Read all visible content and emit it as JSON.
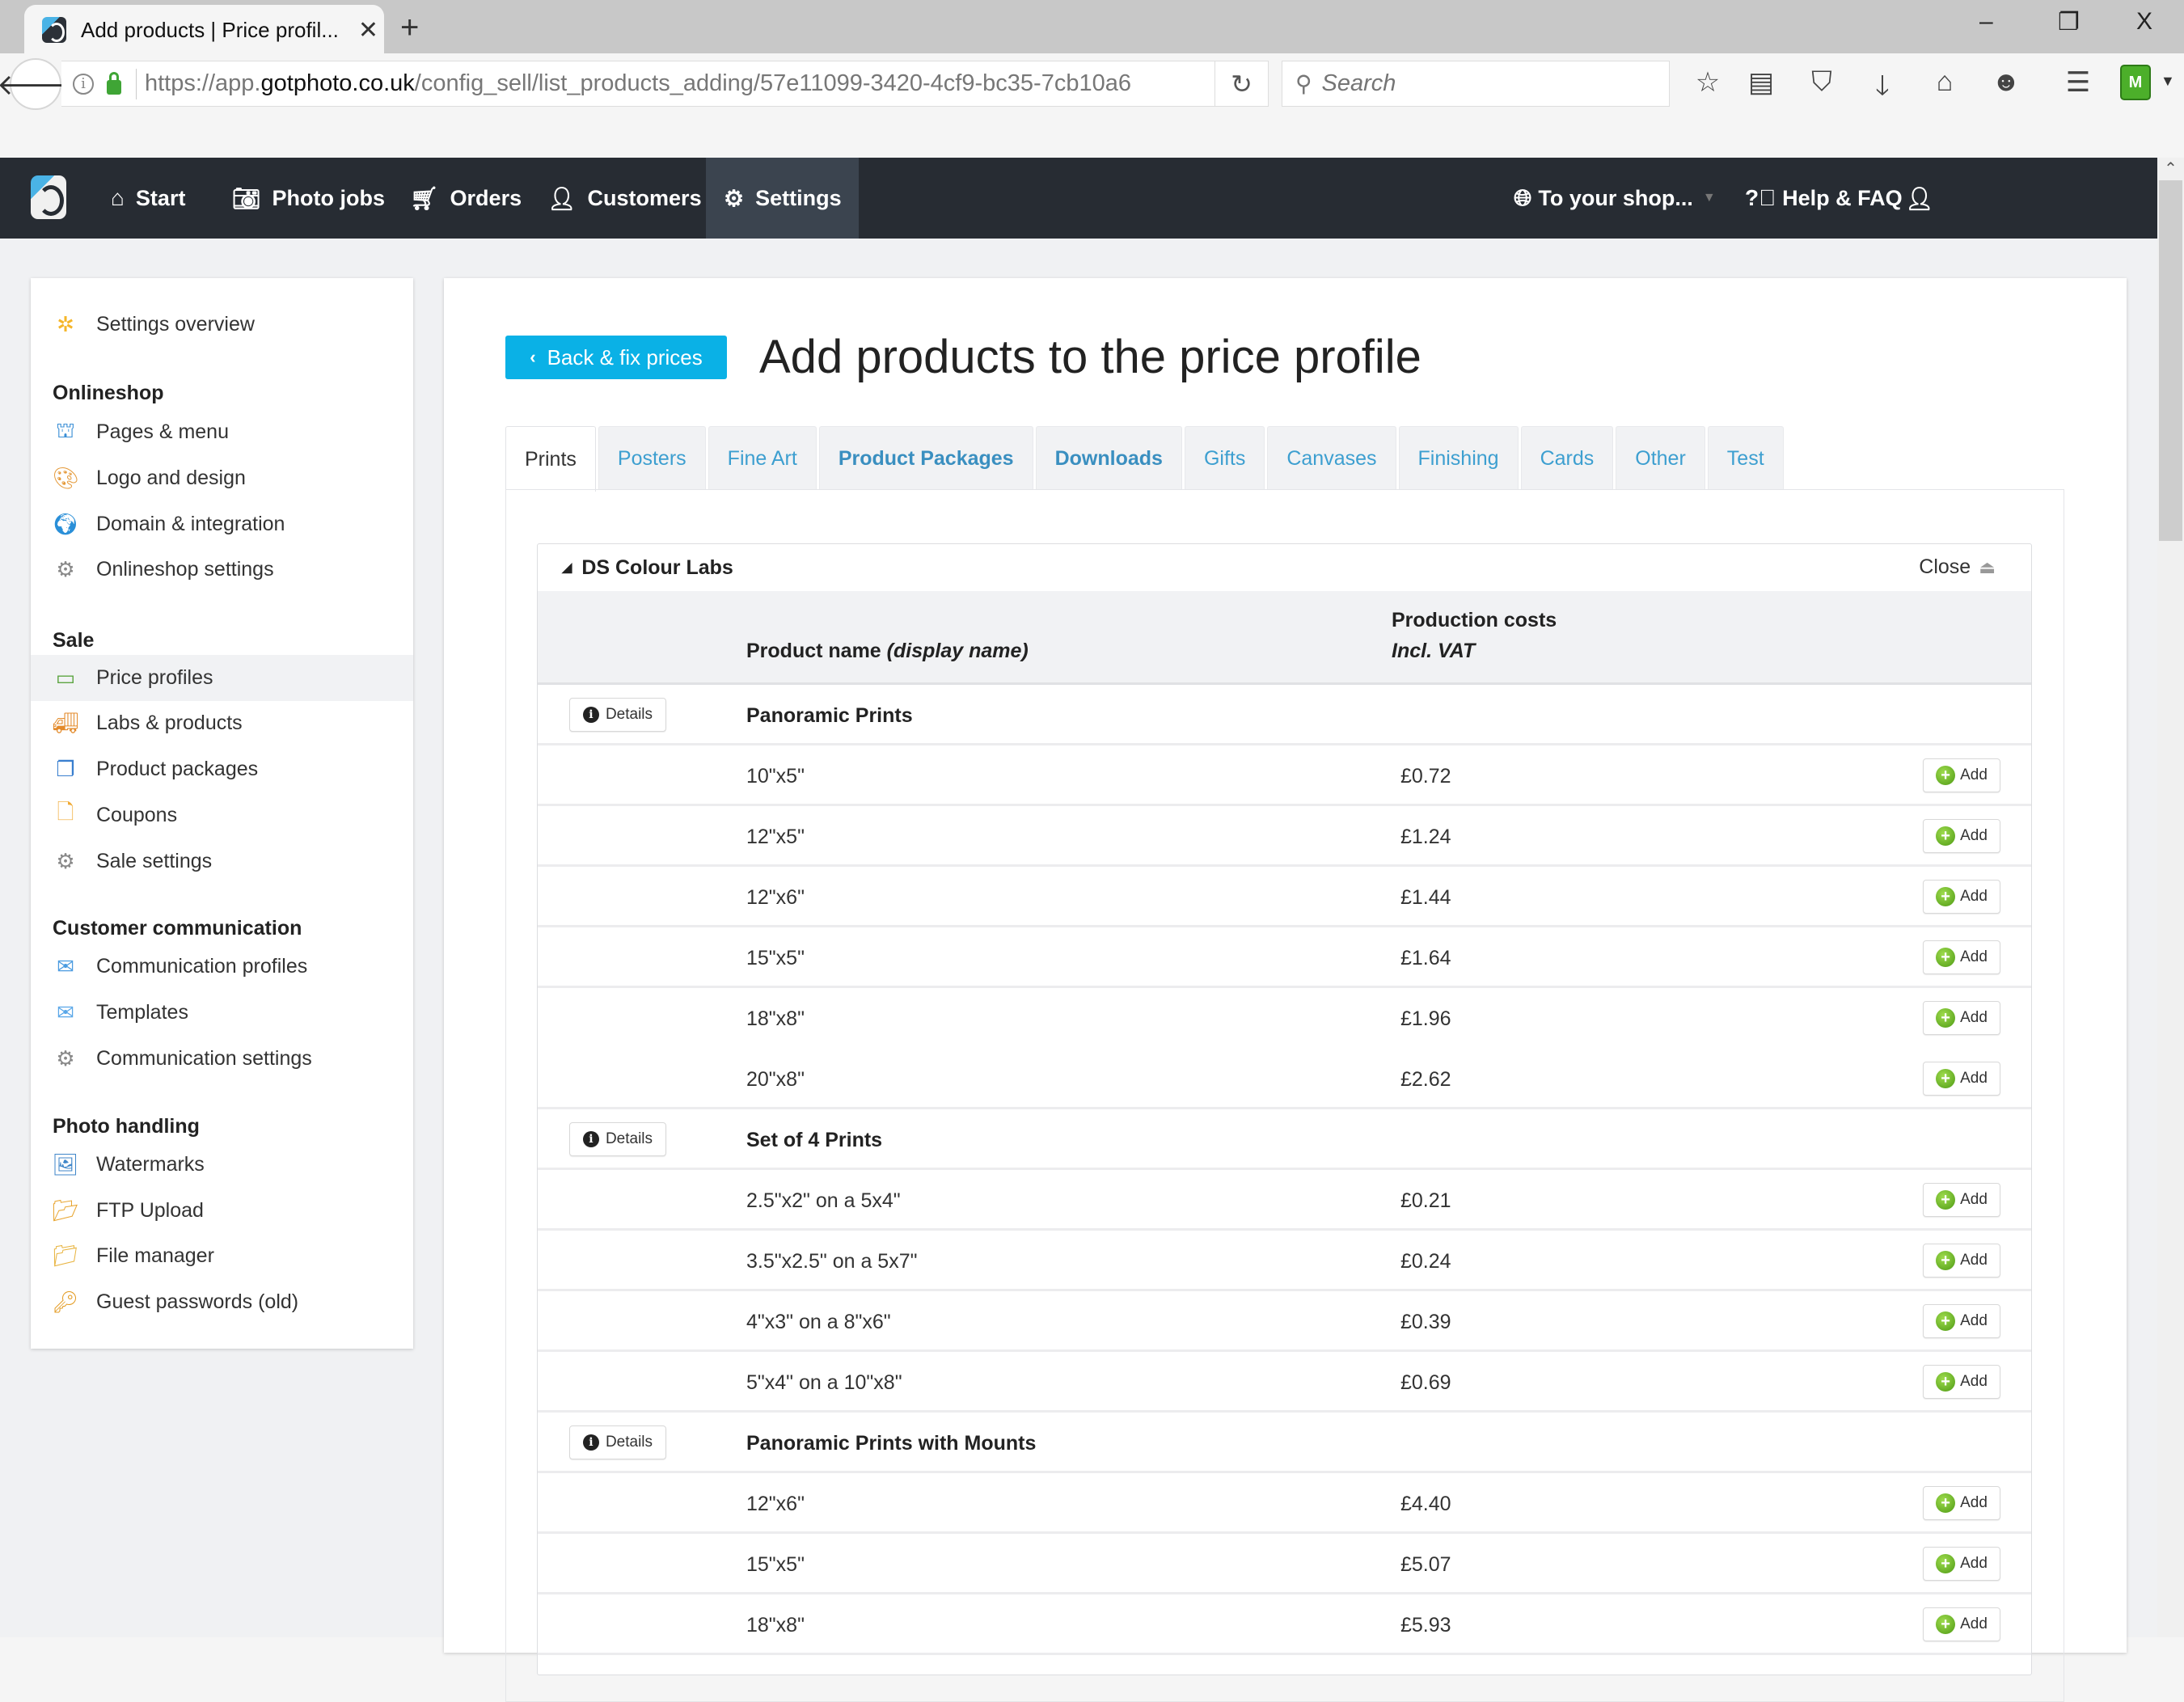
{
  "browser": {
    "tab_title": "Add products | Price profil...",
    "new_tab": "+",
    "window_controls": {
      "minimize": "–",
      "restore": "❐",
      "close": "X"
    },
    "url_prefix": "https://app.",
    "url_domain": "gotphoto.co.uk",
    "url_path": "/config_sell/list_products_adding/57e11099-3420-4cf9-bc35-7cb10a6",
    "search_placeholder": "Search",
    "toolbar_icons": [
      "star-icon",
      "reader-list-icon",
      "pocket-icon",
      "download-icon",
      "home-icon",
      "chat-icon",
      "menu-icon",
      "extension-icon"
    ]
  },
  "navbar": {
    "items": [
      {
        "label": "Start",
        "icon": "home-icon"
      },
      {
        "label": "Photo jobs",
        "icon": "camera-icon"
      },
      {
        "label": "Orders",
        "icon": "cart-icon"
      },
      {
        "label": "Customers",
        "icon": "user-icon"
      },
      {
        "label": "Settings",
        "icon": "gear-icon",
        "active": true
      }
    ],
    "right": {
      "shop": "To your shop...",
      "help": "Help & FAQ",
      "account_icon": "user-icon"
    }
  },
  "sidebar": {
    "overview": "Settings overview",
    "sections": [
      {
        "title": "Onlineshop",
        "items": [
          "Pages & menu",
          "Logo and design",
          "Domain & integration",
          "Onlineshop settings"
        ]
      },
      {
        "title": "Sale",
        "items": [
          "Price profiles",
          "Labs & products",
          "Product packages",
          "Coupons",
          "Sale settings"
        ],
        "active": "Price profiles"
      },
      {
        "title": "Customer communication",
        "items": [
          "Communication profiles",
          "Templates",
          "Communication settings"
        ]
      },
      {
        "title": "Photo handling",
        "items": [
          "Watermarks",
          "FTP Upload",
          "File manager",
          "Guest passwords (old)"
        ]
      }
    ]
  },
  "main": {
    "back_button": "Back & fix prices",
    "title": "Add products to the price profile",
    "tabs": [
      {
        "label": "Prints",
        "active": true
      },
      {
        "label": "Posters"
      },
      {
        "label": "Fine Art"
      },
      {
        "label": "Product Packages",
        "bold": true
      },
      {
        "label": "Downloads",
        "bold": true
      },
      {
        "label": "Gifts"
      },
      {
        "label": "Canvases"
      },
      {
        "label": "Finishing"
      },
      {
        "label": "Cards"
      },
      {
        "label": "Other"
      },
      {
        "label": "Test"
      }
    ],
    "lab": {
      "name": "DS Colour Labs",
      "close_label": "Close",
      "columns": {
        "name": "Product name",
        "name_italic": "(display name)",
        "cost_line1": "Production costs",
        "cost_line2": "Incl. VAT"
      },
      "details_label": "Details",
      "add_label": "Add",
      "groups": [
        {
          "name": "Panoramic Prints",
          "products": [
            {
              "name": "10\"x5\"",
              "price": "£0.72"
            },
            {
              "name": "12\"x5\"",
              "price": "£1.24"
            },
            {
              "name": "12\"x6\"",
              "price": "£1.44"
            },
            {
              "name": "15\"x5\"",
              "price": "£1.64"
            },
            {
              "name": "18\"x8\"",
              "price": "£1.96"
            },
            {
              "name": "20\"x8\"",
              "price": "£2.62"
            }
          ]
        },
        {
          "name": "Set of 4 Prints",
          "products": [
            {
              "name": "2.5\"x2\" on a 5x4\"",
              "price": "£0.21"
            },
            {
              "name": "3.5\"x2.5\" on a 5x7\"",
              "price": "£0.24"
            },
            {
              "name": "4\"x3\" on a 8\"x6\"",
              "price": "£0.39"
            },
            {
              "name": "5\"x4\" on a 10\"x8\"",
              "price": "£0.69"
            }
          ]
        },
        {
          "name": "Panoramic Prints with Mounts",
          "products": [
            {
              "name": "12\"x6\"",
              "price": "£4.40"
            },
            {
              "name": "15\"x5\"",
              "price": "£5.07"
            },
            {
              "name": "18\"x8\"",
              "price": "£5.93"
            }
          ]
        }
      ]
    }
  },
  "colors": {
    "navbar_bg": "#272c33",
    "navbar_active": "#3b444f",
    "accent_button": "#0ab1e6",
    "tab_link": "#3d9fd0",
    "add_green": "#6ab82a"
  }
}
